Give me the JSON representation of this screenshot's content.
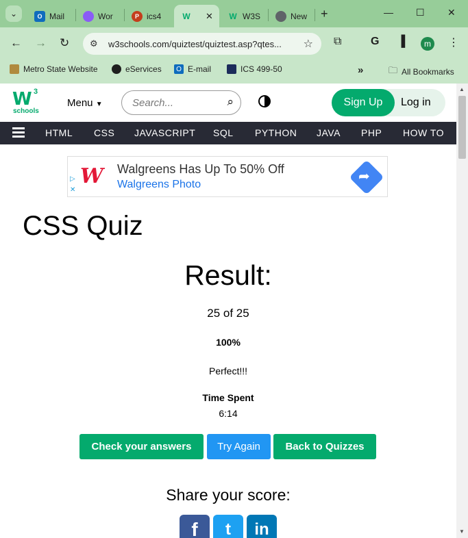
{
  "browser": {
    "tabs": [
      {
        "label": "Mail",
        "icon": "outlook-icon",
        "color": "#0f6cbd"
      },
      {
        "label": "Wor",
        "icon": "copilot-icon",
        "color": "#8a5cf6"
      },
      {
        "label": "ics4",
        "icon": "powerpoint-icon",
        "color": "#c43e1c"
      },
      {
        "label": "",
        "icon": "w3schools-icon",
        "color": "#04aa6d",
        "active": true
      },
      {
        "label": "W3S",
        "icon": "w3schools-icon",
        "color": "#04aa6d"
      },
      {
        "label": "New",
        "icon": "chrome-icon",
        "color": "#5f6368"
      }
    ],
    "url": "w3schools.com/quiztest/quiztest.asp?qtes...",
    "avatar_letter": "m",
    "bookmarks": [
      {
        "label": "Metro State Website"
      },
      {
        "label": "eServices"
      },
      {
        "label": "E-mail"
      },
      {
        "label": "ICS 499-50"
      }
    ],
    "all_bookmarks": "All Bookmarks",
    "overflow": "»"
  },
  "header": {
    "logo_w": "W",
    "logo_sup": "3",
    "logo_text": "schools",
    "menu": "Menu",
    "search_placeholder": "Search...",
    "signup": "Sign Up",
    "login": "Log in"
  },
  "nav": [
    "HTML",
    "CSS",
    "JAVASCRIPT",
    "SQL",
    "PYTHON",
    "JAVA",
    "PHP",
    "HOW TO"
  ],
  "ad": {
    "logo": "W",
    "title": "Walgreens Has Up To 50% Off",
    "subtitle": "Walgreens Photo"
  },
  "quiz": {
    "title": "CSS Quiz",
    "result_heading": "Result:",
    "score": "25 of 25",
    "percent": "100%",
    "message": "Perfect!!!",
    "time_label": "Time Spent",
    "time_value": "6:14",
    "buttons": {
      "check": "Check your answers",
      "retry": "Try Again",
      "back": "Back to Quizzes"
    },
    "share_label": "Share your score:"
  },
  "colors": {
    "brand_green": "#04aa6d",
    "nav_dark": "#282a35",
    "retry_blue": "#2196f3"
  }
}
